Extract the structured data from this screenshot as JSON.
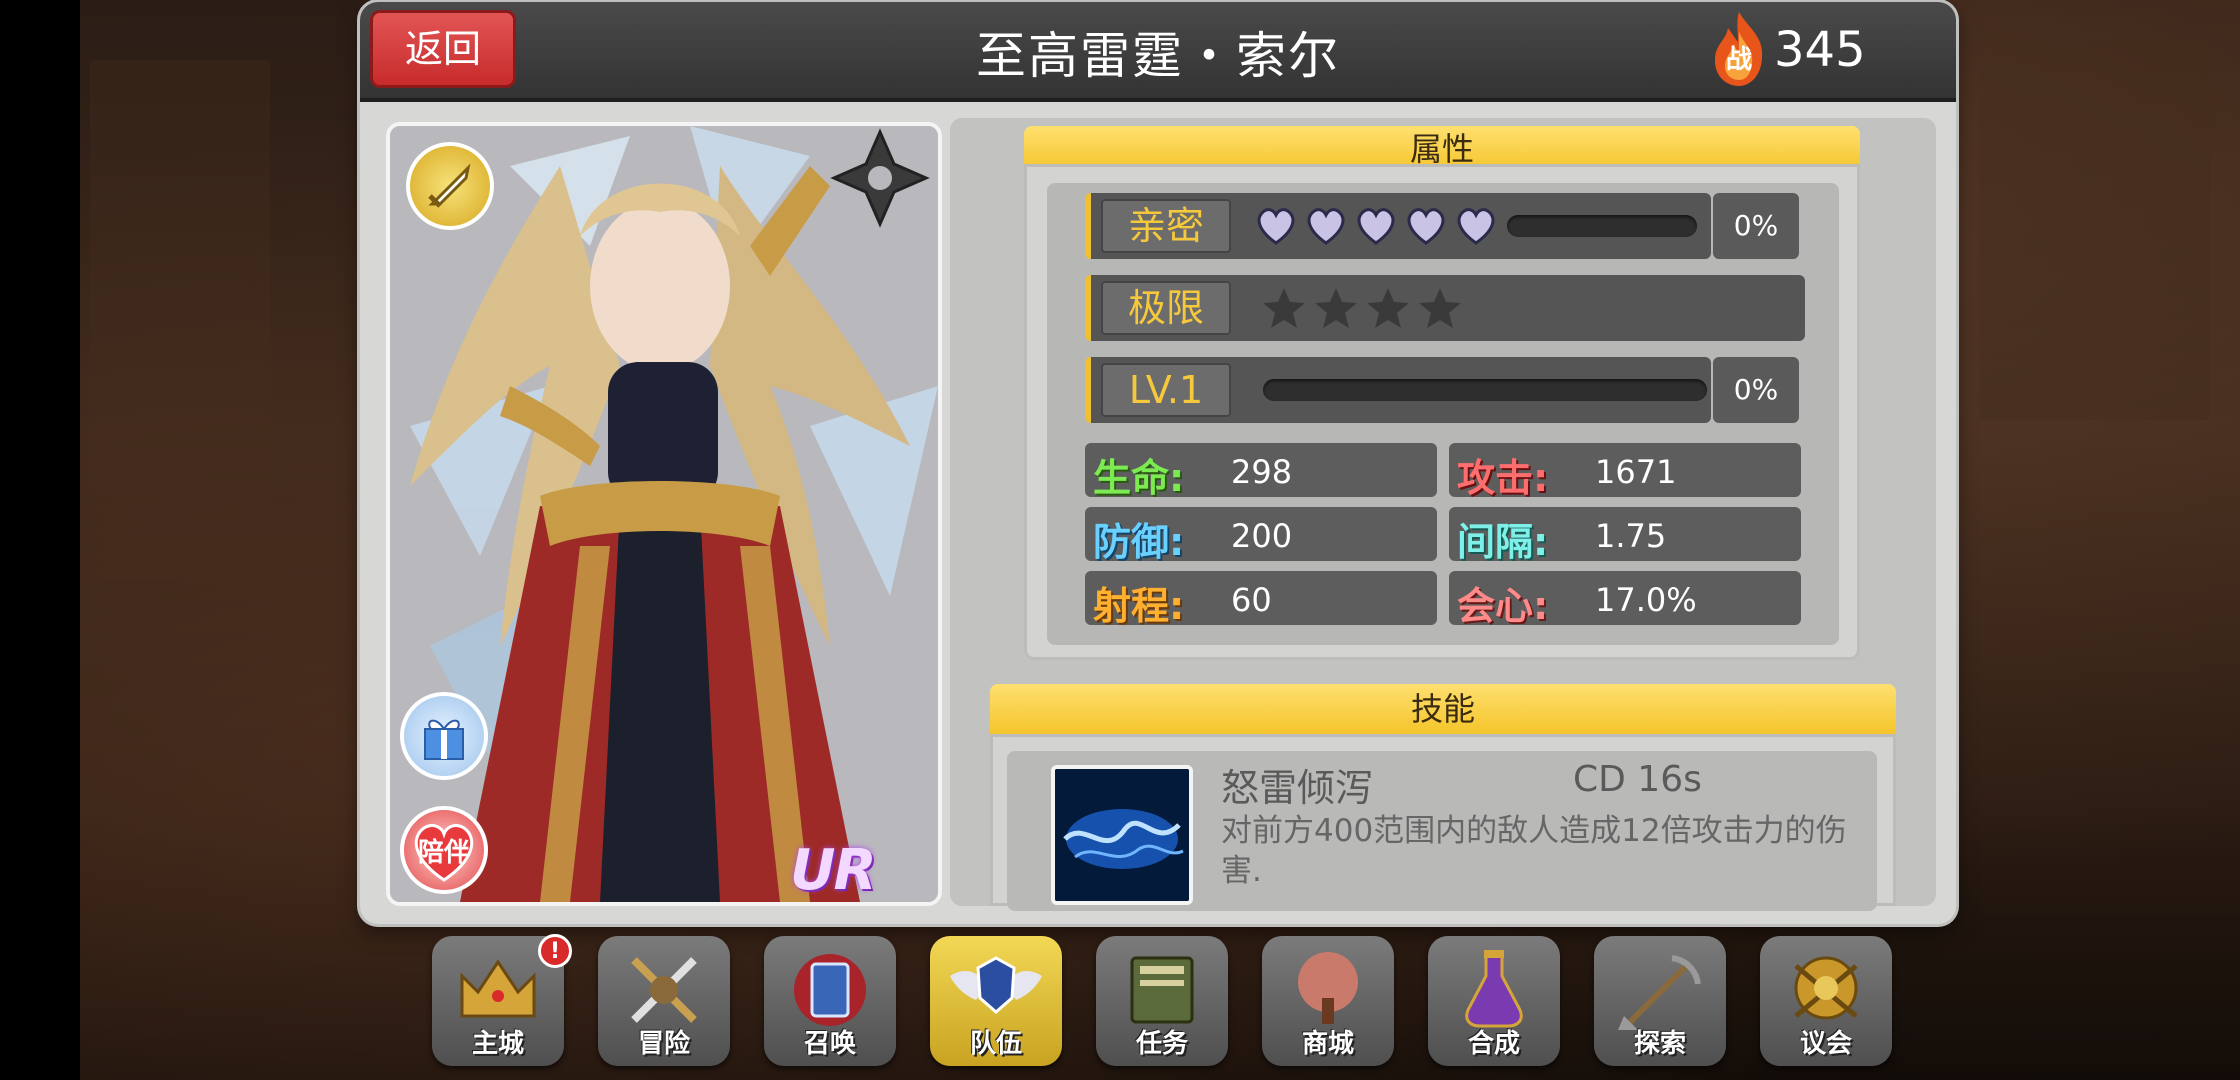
{
  "header": {
    "back_label": "返回",
    "title": "至高雷霆・索尔",
    "power_icon_label": "战",
    "power_value": "345"
  },
  "portrait": {
    "rank_icon": "sword-rank-icon",
    "element_icon": "dark-element-icon",
    "gift_icon": "gift-box-icon",
    "company_label": "陪伴",
    "rarity": "UR"
  },
  "attributes": {
    "section_title": "属性",
    "intimacy": {
      "label": "亲密",
      "hearts": 5,
      "progress": 0,
      "percent": "0%"
    },
    "limit": {
      "label": "极限",
      "stars": 4
    },
    "level": {
      "label": "LV.1",
      "progress": 0,
      "percent": "0%"
    },
    "stats": [
      {
        "name": "生命:",
        "value": "298",
        "color": "green"
      },
      {
        "name": "攻击:",
        "value": "1671",
        "color": "red"
      },
      {
        "name": "防御:",
        "value": "200",
        "color": "blue"
      },
      {
        "name": "间隔:",
        "value": "1.75",
        "color": "cyan"
      },
      {
        "name": "射程:",
        "value": "60",
        "color": "orange"
      },
      {
        "name": "会心:",
        "value": "17.0%",
        "color": "rose"
      }
    ]
  },
  "skills": {
    "section_title": "技能",
    "items": [
      {
        "name": "怒雷倾泻",
        "cd": "CD  16s",
        "description": "对前方400范围内的敌人造成12倍攻击力的伤害."
      }
    ]
  },
  "nav": {
    "items": [
      {
        "label": "主城",
        "icon": "castle-crown-icon",
        "badge": "!"
      },
      {
        "label": "冒险",
        "icon": "crossed-swords-icon"
      },
      {
        "label": "召唤",
        "icon": "summon-card-icon"
      },
      {
        "label": "队伍",
        "icon": "winged-shield-icon",
        "active": true
      },
      {
        "label": "任务",
        "icon": "quest-book-icon"
      },
      {
        "label": "商城",
        "icon": "shop-tree-icon"
      },
      {
        "label": "合成",
        "icon": "potion-flask-icon"
      },
      {
        "label": "探索",
        "icon": "shovel-pickaxe-icon"
      },
      {
        "label": "议会",
        "icon": "council-crest-icon"
      }
    ]
  },
  "colors": {
    "accent_yellow": "#f4c42a",
    "back_red": "#c72b2b",
    "active_nav": "#f2d855"
  }
}
